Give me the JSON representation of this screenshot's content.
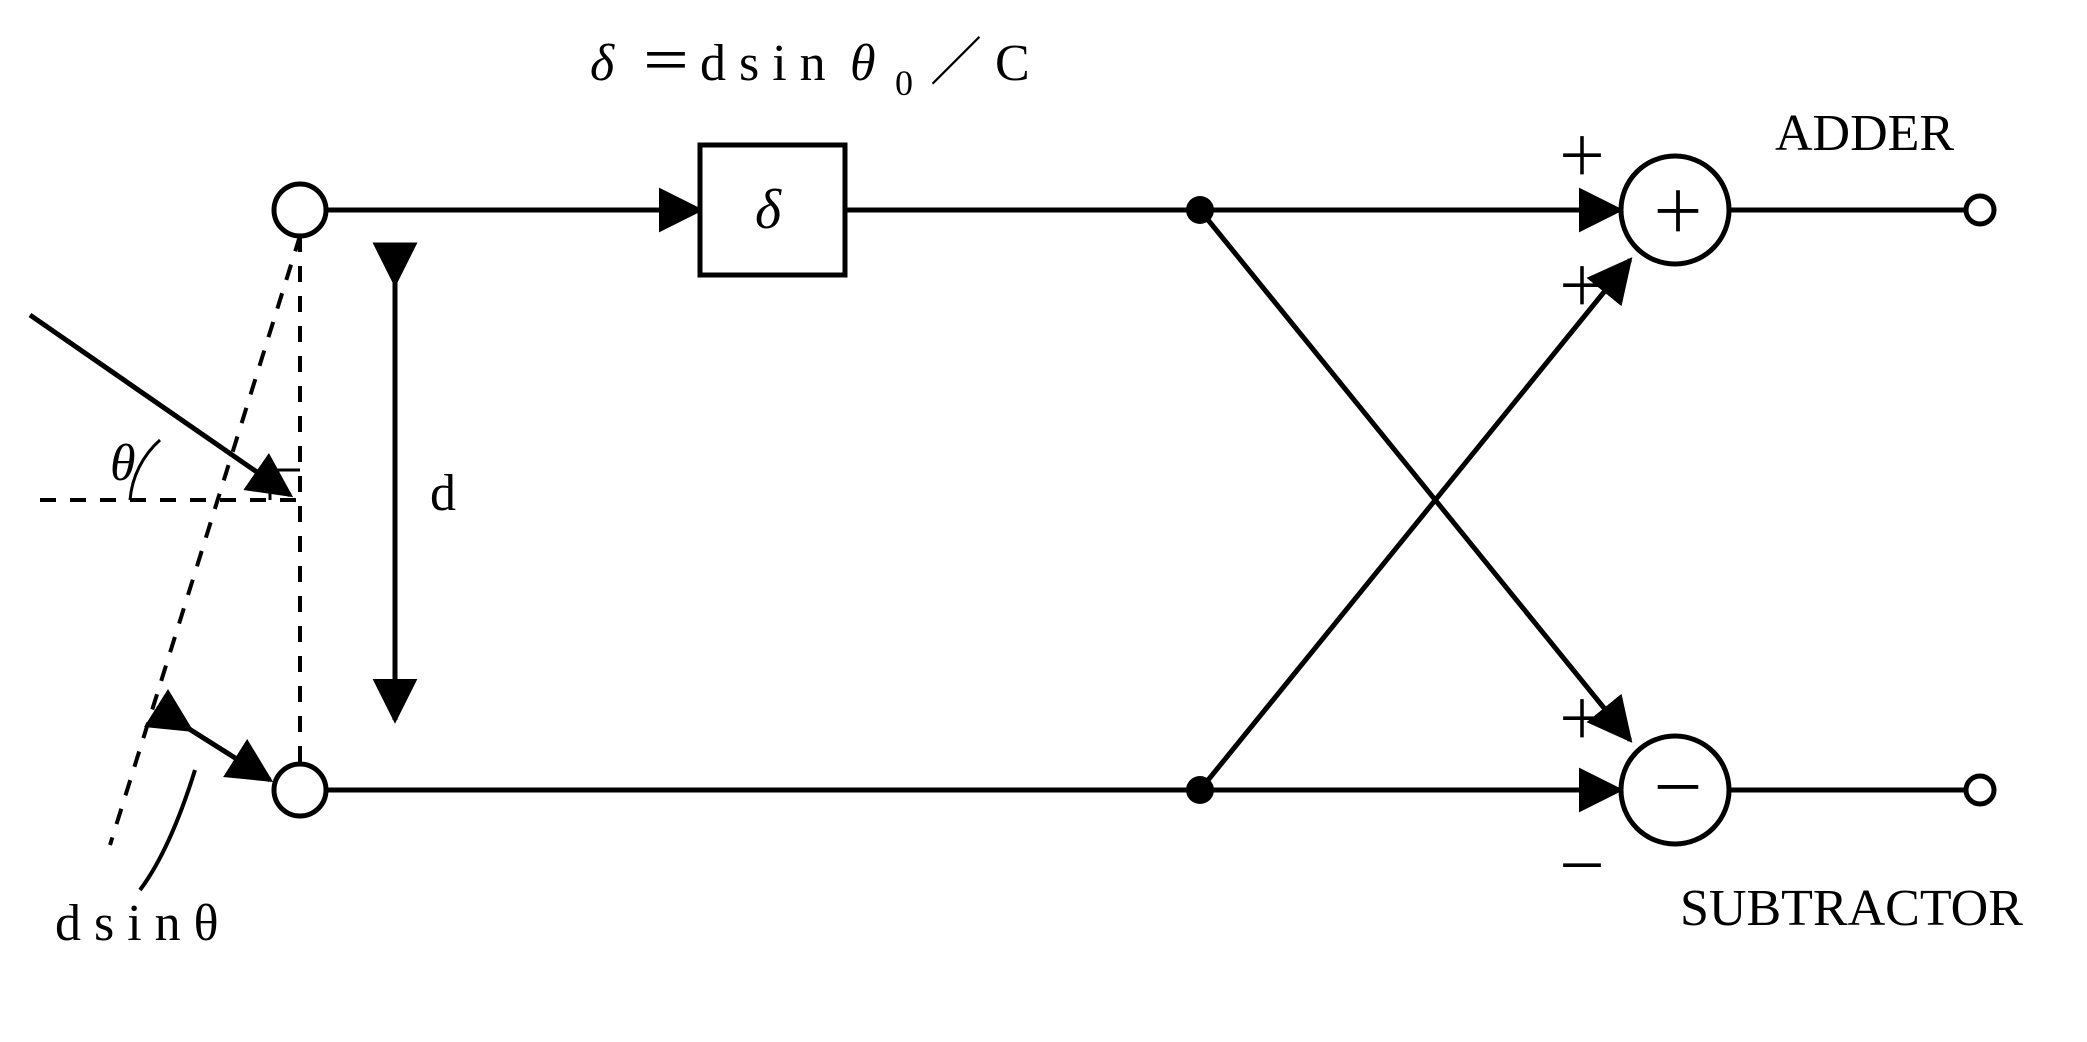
{
  "formula": {
    "lhs": "δ",
    "eq": "＝",
    "rhs1": "d s i n",
    "theta": "θ",
    "sub0": "0",
    "slash": "／",
    "C": "C"
  },
  "delta_block": "δ",
  "theta_label": "θ",
  "d_label": "d",
  "dsin_theta_label": "d s i n θ",
  "adder": {
    "label": "ADDER",
    "sign_top": "＋",
    "sign_bottom": "＋",
    "symbol": "＋"
  },
  "subtractor": {
    "label": "SUBTRACTOR",
    "sign_top": "＋",
    "sign_bottom": "－",
    "symbol": "－"
  }
}
